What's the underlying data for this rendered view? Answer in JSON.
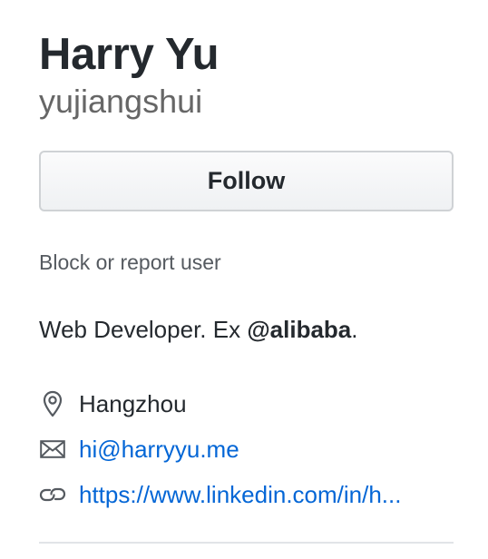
{
  "profile": {
    "full_name": "Harry Yu",
    "username": "yujiangshui",
    "follow_label": "Follow",
    "block_label": "Block or report user",
    "bio": {
      "prefix": "Web Developer. Ex ",
      "mention": "@alibaba",
      "suffix": "."
    },
    "details": {
      "location": "Hangzhou",
      "email": "hi@harryyu.me",
      "website": "https://www.linkedin.com/in/h..."
    }
  },
  "icons": {
    "location": "location-pin-icon",
    "email": "mail-icon",
    "website": "link-icon"
  },
  "colors": {
    "text": "#24292e",
    "muted": "#666666",
    "link": "#0366d6",
    "button_border": "#cfd2d5",
    "divider": "#e1e4e8"
  }
}
